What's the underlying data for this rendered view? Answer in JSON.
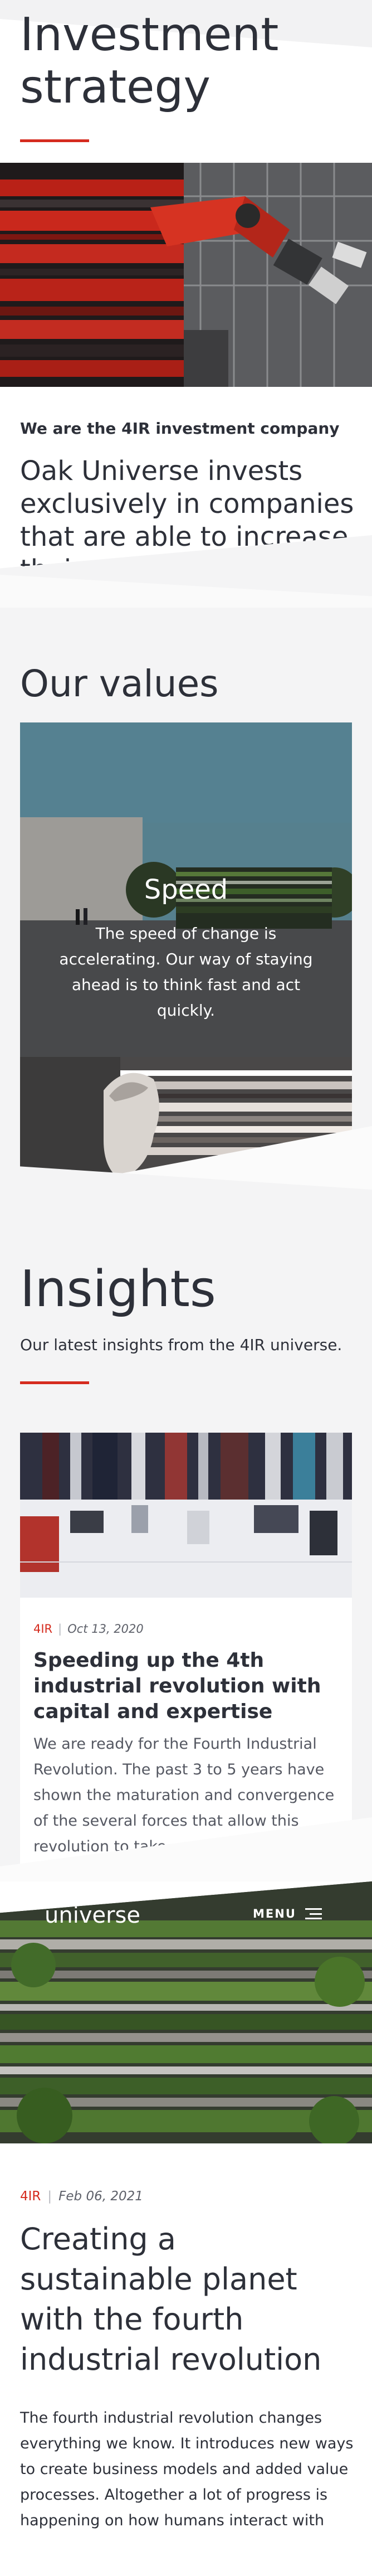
{
  "strategy": {
    "title": "Investment strategy",
    "kicker": "We are the 4IR investment company",
    "lead": "Oak Universe invests exclusively in companies that are able to increase their value sig"
  },
  "values": {
    "title": "Our values",
    "card_title": "Speed",
    "card_text": "The speed of change is accelerating. Our way of staying ahead is to think fast and act quickly."
  },
  "insights": {
    "title": "Insights",
    "subtitle": "Our latest insights from the 4IR universe.",
    "card": {
      "category": "4IR",
      "separator": "|",
      "date": "Oct 13, 2020",
      "title": "Speeding up the 4th industrial revolution with capital and expertise",
      "body": "We are ready for the Fourth Industrial Revolution. The past 3 to 5 years have shown the maturation and convergence of the several forces that allow this revolution to take"
    }
  },
  "article": {
    "brand": "universe",
    "menu_label": "MENU",
    "category": "4IR",
    "separator": "|",
    "date": "Feb 06, 2021",
    "title": "Creating a sustainable planet with the fourth industrial revolution",
    "body": "The fourth industrial revolution changes everything we know. It introduces new ways to create business models and added value processes. Altogether a lot of progress is happening on how humans interact with"
  },
  "colors": {
    "accent": "#d52b1e",
    "text": "#2d3039",
    "section_bg": "#f4f4f5"
  }
}
